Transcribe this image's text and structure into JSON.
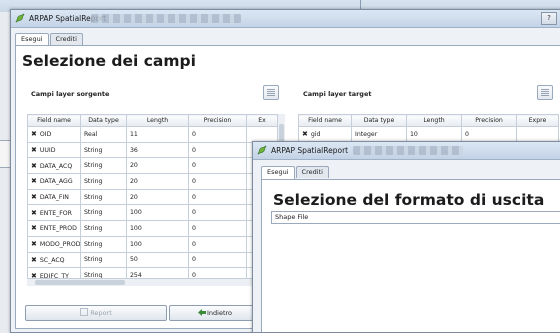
{
  "window_back": {
    "title": "ARPAP SpatialReport",
    "tabs": [
      "Esegui",
      "Crediti"
    ],
    "heading": "Selezione dei campi",
    "source_group_label": "Campi layer sorgente",
    "target_group_label": "Campi layer target",
    "source_columns": [
      "Field name",
      "Data type",
      "Length",
      "Precision",
      "Ex"
    ],
    "source_rows": [
      {
        "name": "OID",
        "type": "Real",
        "length": "11",
        "precision": "0"
      },
      {
        "name": "UUID",
        "type": "String",
        "length": "36",
        "precision": "0"
      },
      {
        "name": "DATA_ACQ",
        "type": "String",
        "length": "20",
        "precision": "0"
      },
      {
        "name": "DATA_AGG",
        "type": "String",
        "length": "20",
        "precision": "0"
      },
      {
        "name": "DATA_FIN",
        "type": "String",
        "length": "20",
        "precision": "0"
      },
      {
        "name": "ENTE_FOR",
        "type": "String",
        "length": "100",
        "precision": "0"
      },
      {
        "name": "ENTE_PROD",
        "type": "String",
        "length": "100",
        "precision": "0"
      },
      {
        "name": "MODO_PROD",
        "type": "String",
        "length": "100",
        "precision": "0"
      },
      {
        "name": "SC_ACQ",
        "type": "String",
        "length": "50",
        "precision": "0"
      },
      {
        "name": "EDIFC_TY",
        "type": "String",
        "length": "254",
        "precision": "0"
      }
    ],
    "target_columns": [
      "Field name",
      "Data type",
      "Length",
      "Precision",
      "Expre"
    ],
    "target_rows": [
      {
        "name": "gid",
        "type": "Integer",
        "length": "10",
        "precision": "0"
      }
    ],
    "report_button": "Report",
    "back_button": "Indietro"
  },
  "window_front": {
    "title": "ARPAP SpatialReport",
    "tabs": [
      "Esegui",
      "Crediti"
    ],
    "heading": "Selezione del formato di uscita",
    "format_value": "Shape File"
  },
  "colors": {
    "titlebar": "#c3d3e6",
    "window_bg": "#eef1f5",
    "close_button": "#c34a35",
    "back_arrow": "#3a8a3a"
  },
  "icons": {
    "app": "qgis-leaf-icon",
    "table_options": "table-settings-icon",
    "back": "green-arrow-left-icon",
    "report": "report-icon",
    "checkmark": "x-mark-icon"
  }
}
